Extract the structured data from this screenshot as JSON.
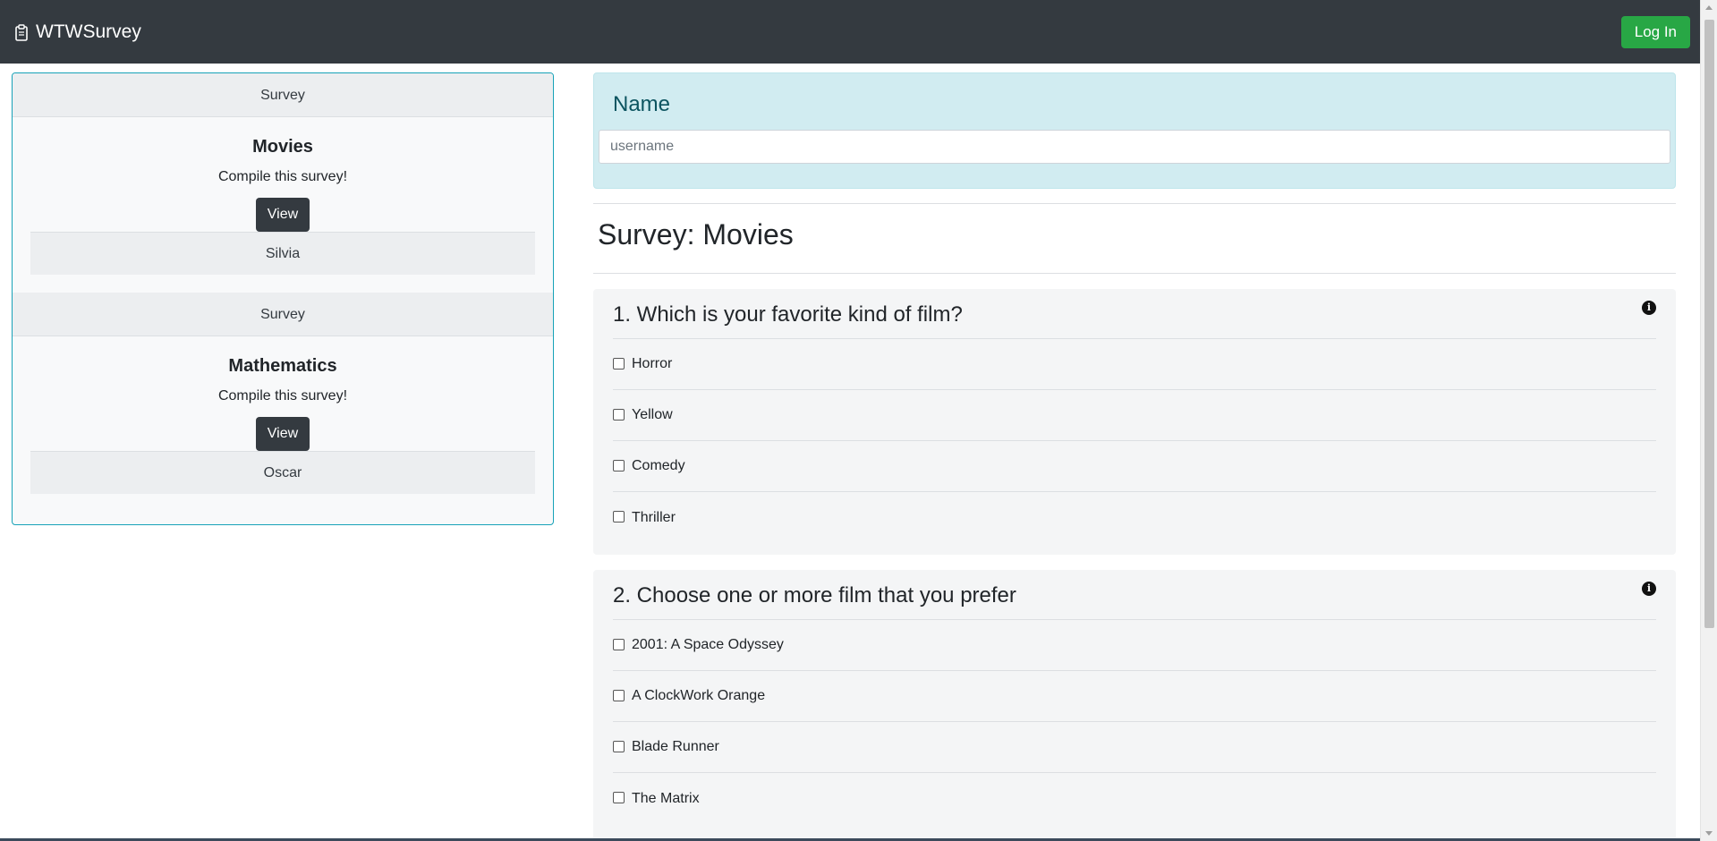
{
  "navbar": {
    "brand": "WTWSurvey",
    "brand_icon": "clipboard-icon",
    "login_label": "Log In",
    "login_color": "#28a745",
    "background": "#343a40"
  },
  "sidebar": {
    "cards": [
      {
        "header": "Survey",
        "title": "Movies",
        "text": "Compile this survey!",
        "button": "View",
        "footer": "Silvia"
      },
      {
        "header": "Survey",
        "title": "Mathematics",
        "text": "Compile this survey!",
        "button": "View",
        "footer": "Oscar"
      }
    ]
  },
  "main": {
    "name_label": "Name",
    "name_placeholder": "username",
    "survey_title": "Survey: Movies",
    "questions": [
      {
        "text": "1. Which is your favorite kind of film?",
        "info_icon": "info-icon",
        "options": [
          "Horror",
          "Yellow",
          "Comedy",
          "Thriller"
        ]
      },
      {
        "text": "2. Choose one or more film that you prefer",
        "info_icon": "info-icon",
        "options": [
          "2001: A Space Odyssey",
          "A ClockWork Orange",
          "Blade Runner",
          "The Matrix"
        ]
      }
    ]
  }
}
